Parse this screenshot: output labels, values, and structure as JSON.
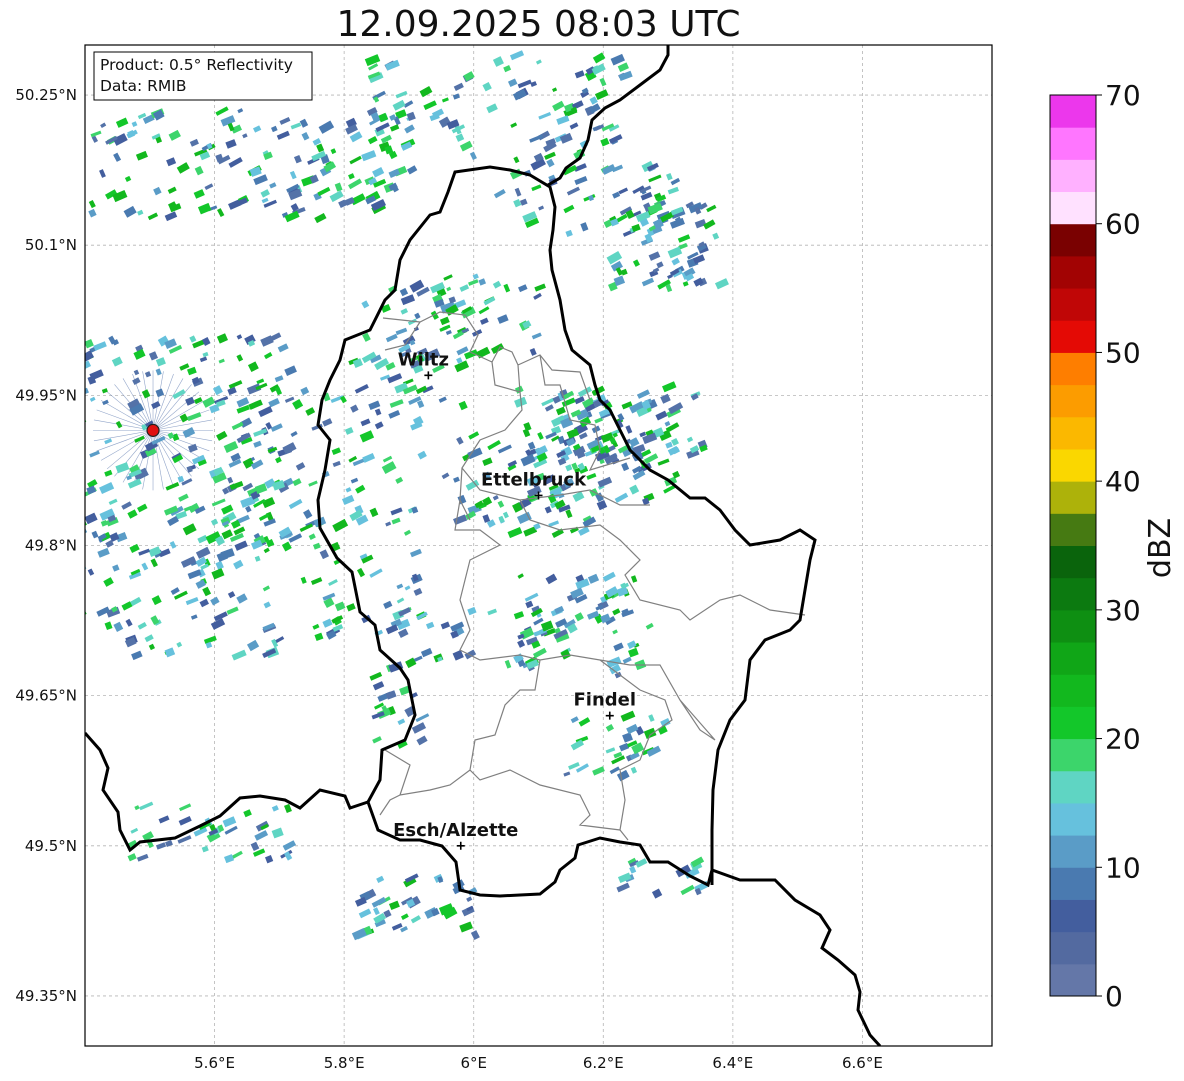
{
  "title": "12.09.2025 08:03 UTC",
  "info": {
    "product": "Product: 0.5° Reflectivity",
    "data": "Data: RMIB"
  },
  "lat_ticks": [
    "50.25°N",
    "50.1°N",
    "49.95°N",
    "49.8°N",
    "49.65°N",
    "49.5°N",
    "49.35°N"
  ],
  "lon_ticks": [
    "5.6°E",
    "5.8°E",
    "6°E",
    "6.2°E",
    "6.4°E",
    "6.6°E"
  ],
  "cities": [
    {
      "name": "Wiltz",
      "lon": 5.93,
      "lat": 49.97
    },
    {
      "name": "Ettelbruck",
      "lon": 6.1,
      "lat": 49.85
    },
    {
      "name": "Findel",
      "lon": 6.21,
      "lat": 49.63
    },
    {
      "name": "Esch/Alzette",
      "lon": 5.98,
      "lat": 49.5
    }
  ],
  "radar_site": {
    "lon": 5.505,
    "lat": 49.915,
    "color": "#e01010"
  },
  "colorbar": {
    "label": "dBZ",
    "ticks": [
      "0",
      "10",
      "20",
      "30",
      "40",
      "50",
      "60",
      "70"
    ],
    "min": 0,
    "max": 70,
    "step": 2.5,
    "colors": [
      "#6477a8",
      "#536aa0",
      "#435e9e",
      "#4a7ab0",
      "#5a9cc7",
      "#66c1dd",
      "#5fd5c3",
      "#3cd56b",
      "#13c72a",
      "#12b81e",
      "#10a617",
      "#0e8f12",
      "#0c7a10",
      "#0a640c",
      "#467a12",
      "#adb20a",
      "#fad700",
      "#fbb800",
      "#fc9c00",
      "#fe7e00",
      "#e40a05",
      "#c00606",
      "#a20303",
      "#7a0101",
      "#ffe1ff",
      "#ffb1ff",
      "#ff76ff",
      "#ec37ec"
    ]
  },
  "map_extent": {
    "lon_min": 5.4,
    "lon_max": 6.8,
    "lat_min": 49.3,
    "lat_max": 50.3
  }
}
